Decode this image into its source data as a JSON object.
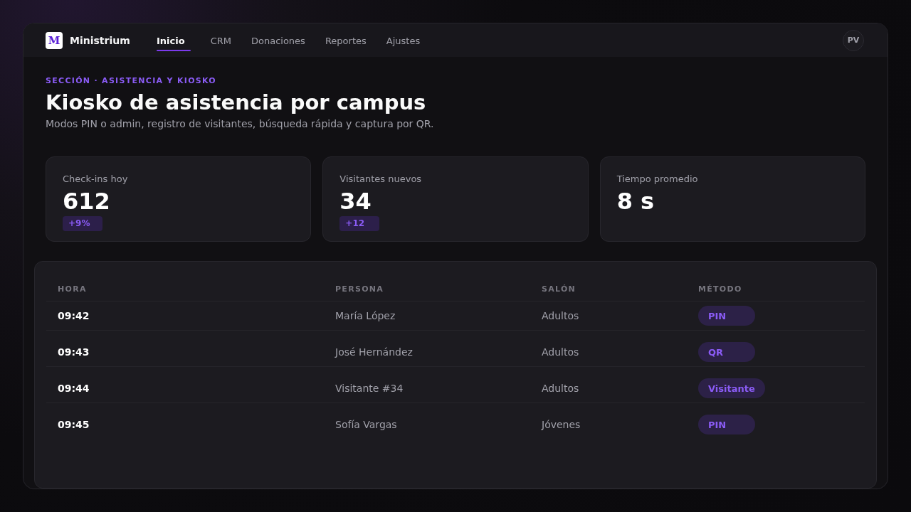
{
  "brand": {
    "logo": "M",
    "name": "Ministrium"
  },
  "nav": {
    "tabs": [
      {
        "label": "Inicio",
        "selected": true
      },
      {
        "label": "CRM",
        "selected": false
      },
      {
        "label": "Donaciones",
        "selected": false
      },
      {
        "label": "Reportes",
        "selected": false
      },
      {
        "label": "Ajustes",
        "selected": false
      }
    ]
  },
  "user": {
    "initials": "PV"
  },
  "header": {
    "eyebrow": "SECCIÓN · ASISTENCIA Y KIOSKO",
    "title": "Kiosko de asistencia por campus",
    "subtitle": "Modos PIN o admin, registro de visitantes, búsqueda rápida y captura por QR."
  },
  "stats": [
    {
      "label": "Check-ins hoy",
      "value": "612",
      "delta": "+9%"
    },
    {
      "label": "Visitantes nuevos",
      "value": "34",
      "delta": "+12"
    },
    {
      "label": "Tiempo promedio",
      "value": "8 s"
    }
  ],
  "table": {
    "columns": [
      "HORA",
      "PERSONA",
      "SALÓN",
      "MÉTODO"
    ],
    "rows": [
      {
        "hora": "09:42",
        "persona": "María López",
        "salon": "Adultos",
        "metodo": "PIN"
      },
      {
        "hora": "09:43",
        "persona": "José Hernández",
        "salon": "Adultos",
        "metodo": "QR"
      },
      {
        "hora": "09:44",
        "persona": "Visitante #34",
        "salon": "Adultos",
        "metodo": "Visitante"
      },
      {
        "hora": "09:45",
        "persona": "Sofía Vargas",
        "salon": "Jóvenes",
        "metodo": "PIN"
      }
    ]
  }
}
